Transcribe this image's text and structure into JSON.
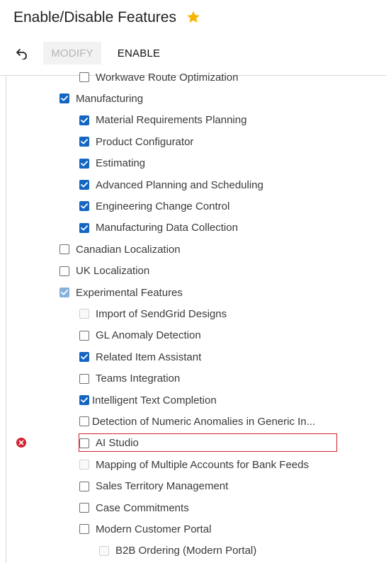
{
  "header": {
    "title": "Enable/Disable Features",
    "favorite_icon": "star-icon",
    "favorite_color": "#f5b400"
  },
  "toolbar": {
    "undo_icon": "undo-icon",
    "modify_label": "MODIFY",
    "enable_label": "ENABLE"
  },
  "colors": {
    "accent": "#1466c2",
    "error": "#d1242f"
  },
  "features": [
    {
      "label": "Workwave Route Optimization",
      "state": "unchecked",
      "level": 2
    },
    {
      "label": "Manufacturing",
      "state": "checked",
      "level": 1
    },
    {
      "label": "Material Requirements Planning",
      "state": "checked",
      "level": 2
    },
    {
      "label": "Product Configurator",
      "state": "checked",
      "level": 2
    },
    {
      "label": "Estimating",
      "state": "checked",
      "level": 2
    },
    {
      "label": "Advanced Planning and Scheduling",
      "state": "checked",
      "level": 2
    },
    {
      "label": "Engineering Change Control",
      "state": "checked",
      "level": 2
    },
    {
      "label": "Manufacturing Data Collection",
      "state": "checked",
      "level": 2
    },
    {
      "label": "Canadian Localization",
      "state": "unchecked",
      "level": 1
    },
    {
      "label": "UK Localization",
      "state": "unchecked",
      "level": 1
    },
    {
      "label": "Experimental Features",
      "state": "checked-disabled",
      "level": 1
    },
    {
      "label": "Import of SendGrid Designs",
      "state": "disabled",
      "level": 2
    },
    {
      "label": "GL Anomaly Detection",
      "state": "unchecked",
      "level": 2
    },
    {
      "label": "Related Item Assistant",
      "state": "checked",
      "level": 2
    },
    {
      "label": "Teams Integration",
      "state": "unchecked",
      "level": 2
    },
    {
      "label": "Intelligent Text Completion",
      "state": "checked",
      "level": 2
    },
    {
      "label": "Detection of Numeric Anomalies in Generic In...",
      "state": "unchecked",
      "level": 2
    },
    {
      "label": "AI Studio",
      "state": "unchecked-error",
      "level": 2
    },
    {
      "label": "Mapping of Multiple Accounts for Bank Feeds",
      "state": "disabled",
      "level": 2
    },
    {
      "label": "Sales Territory Management",
      "state": "unchecked",
      "level": 2
    },
    {
      "label": "Case Commitments",
      "state": "unchecked",
      "level": 2
    },
    {
      "label": "Modern Customer Portal",
      "state": "unchecked",
      "level": 2
    },
    {
      "label": "B2B Ordering (Modern Portal)",
      "state": "disabled",
      "level": 3
    }
  ],
  "validation": {
    "error_icon": "error-icon"
  }
}
